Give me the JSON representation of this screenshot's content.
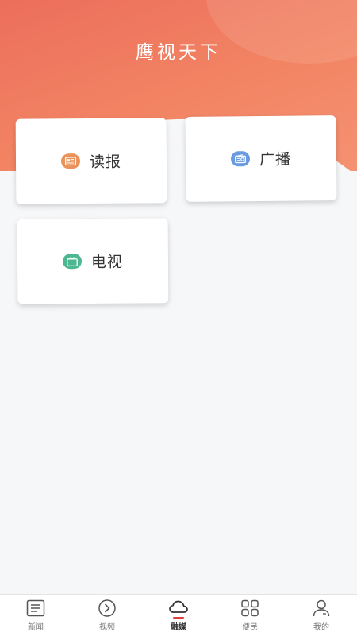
{
  "header": {
    "title": "鹰视天下"
  },
  "cards": [
    {
      "label": "读报",
      "icon": "newspaper-icon",
      "color": "#e9935a"
    },
    {
      "label": "广播",
      "icon": "radio-icon",
      "color": "#6a9be0"
    },
    {
      "label": "电视",
      "icon": "tv-icon",
      "color": "#4cb892"
    }
  ],
  "tabbar": {
    "active_color": "#e0403a",
    "tabs": [
      {
        "label": "新闻",
        "icon": "news-list-icon"
      },
      {
        "label": "视频",
        "icon": "play-circle-icon"
      },
      {
        "label": "融媒",
        "icon": "cloud-icon",
        "active": true
      },
      {
        "label": "便民",
        "icon": "grid-apps-icon"
      },
      {
        "label": "我的",
        "icon": "user-icon"
      }
    ]
  }
}
